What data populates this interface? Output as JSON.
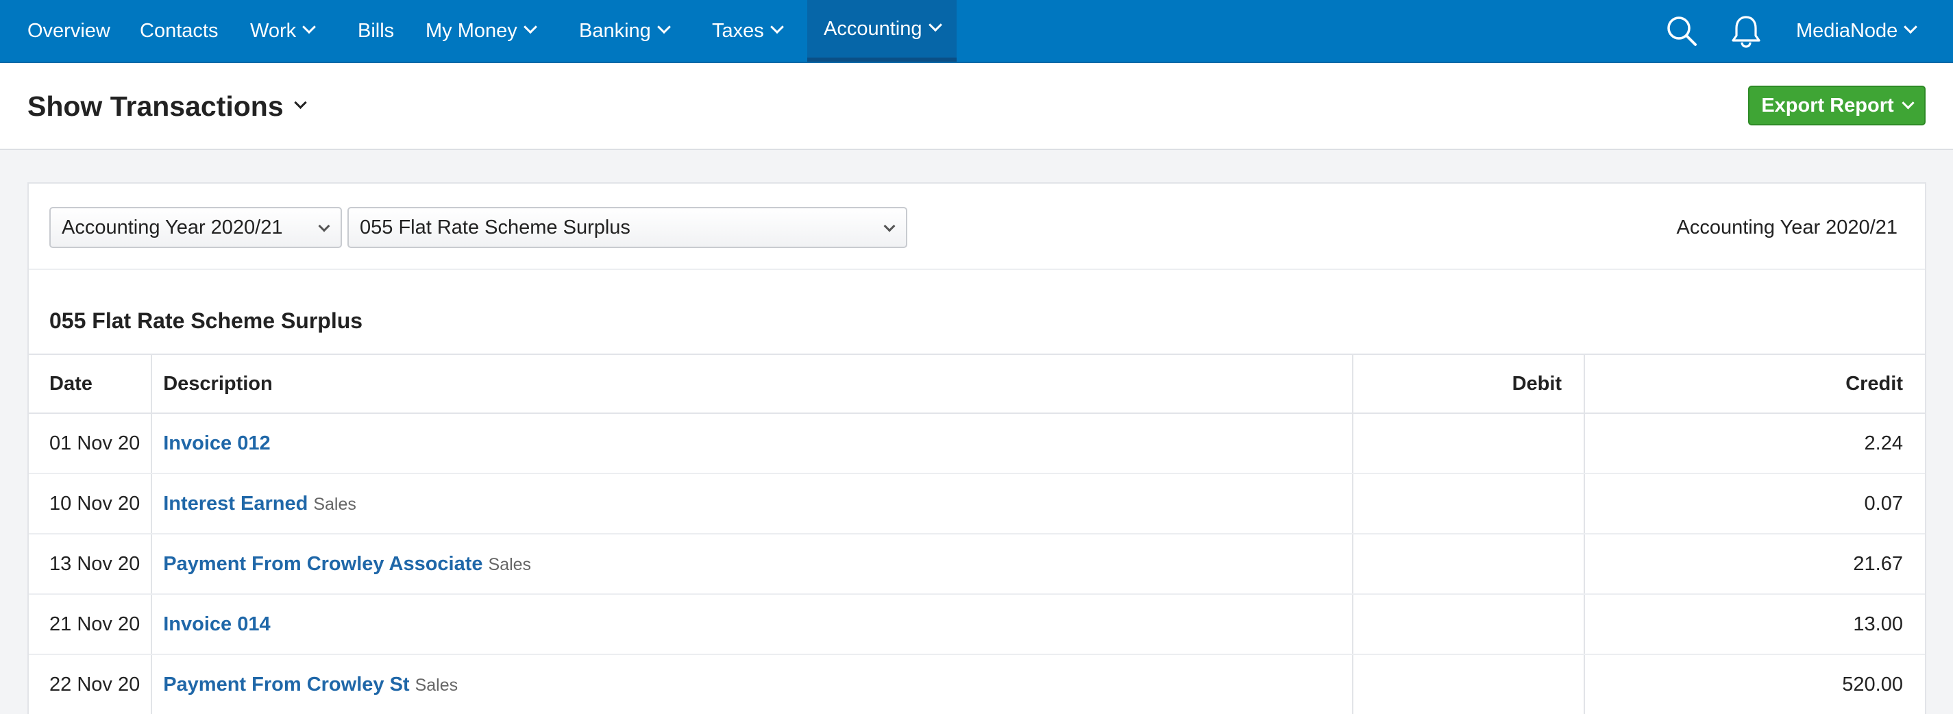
{
  "nav": {
    "items": [
      {
        "label": "Overview",
        "dropdown": false
      },
      {
        "label": "Contacts",
        "dropdown": false
      },
      {
        "label": "Work",
        "dropdown": true
      },
      {
        "label": "Bills",
        "dropdown": false
      },
      {
        "label": "My Money",
        "dropdown": true
      },
      {
        "label": "Banking",
        "dropdown": true
      },
      {
        "label": "Taxes",
        "dropdown": true
      },
      {
        "label": "Accounting",
        "dropdown": true,
        "active": true
      }
    ],
    "account_label": "MediaNode",
    "icons": [
      "search-icon",
      "bell-icon"
    ]
  },
  "header": {
    "title": "Show Transactions",
    "export_label": "Export Report"
  },
  "filters": {
    "period_select": "Accounting Year 2020/21",
    "account_select": "055 Flat Rate Scheme Surplus",
    "period_label": "Accounting Year 2020/21"
  },
  "report": {
    "account_title": "055 Flat Rate Scheme Surplus",
    "columns": [
      "Date",
      "Description",
      "Debit",
      "Credit"
    ],
    "rows": [
      {
        "date": "01 Nov 20",
        "description": "Invoice 012",
        "tag": "",
        "debit": "",
        "credit": "2.24"
      },
      {
        "date": "10 Nov 20",
        "description": "Interest Earned",
        "tag": "Sales",
        "debit": "",
        "credit": "0.07"
      },
      {
        "date": "13 Nov 20",
        "description": "Payment From Crowley Associate",
        "tag": "Sales",
        "debit": "",
        "credit": "21.67"
      },
      {
        "date": "21 Nov 20",
        "description": "Invoice 014",
        "tag": "",
        "debit": "",
        "credit": "13.00"
      },
      {
        "date": "22 Nov 20",
        "description": "Payment From Crowley St",
        "tag": "Sales",
        "debit": "",
        "credit": "520.00"
      }
    ]
  },
  "colors": {
    "nav_bg": "#0077c0",
    "link": "#1f67a8",
    "export_button": "#3fa535"
  }
}
